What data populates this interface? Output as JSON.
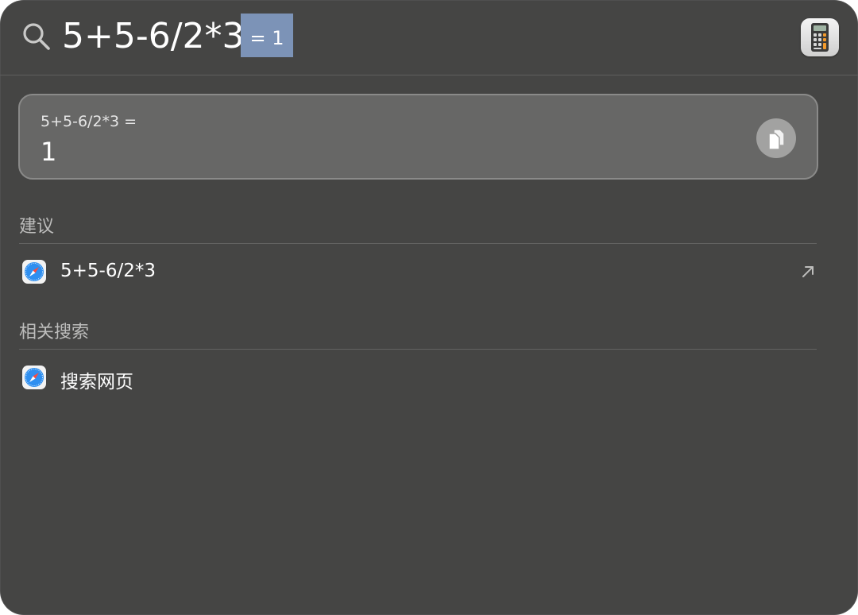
{
  "search": {
    "query": "5+5-6/2*3",
    "inline_result": "= 1"
  },
  "top_app_icon": "calculator-icon",
  "result_card": {
    "expression": "5+5-6/2*3 =",
    "value": "1",
    "action_icon": "copy-icon"
  },
  "sections": [
    {
      "title": "建议",
      "items": [
        {
          "icon": "safari-icon",
          "label": "5+5-6/2*3",
          "trailing_icon": "open-external-arrow-icon"
        }
      ]
    },
    {
      "title": "相关搜索",
      "items": [
        {
          "icon": "safari-icon",
          "label": "搜索网页"
        }
      ]
    }
  ],
  "colors": {
    "window_bg": "#454544",
    "card_bg": "#676766",
    "selection": "#7c93b7",
    "safari_blue": "#2f8ff0"
  }
}
